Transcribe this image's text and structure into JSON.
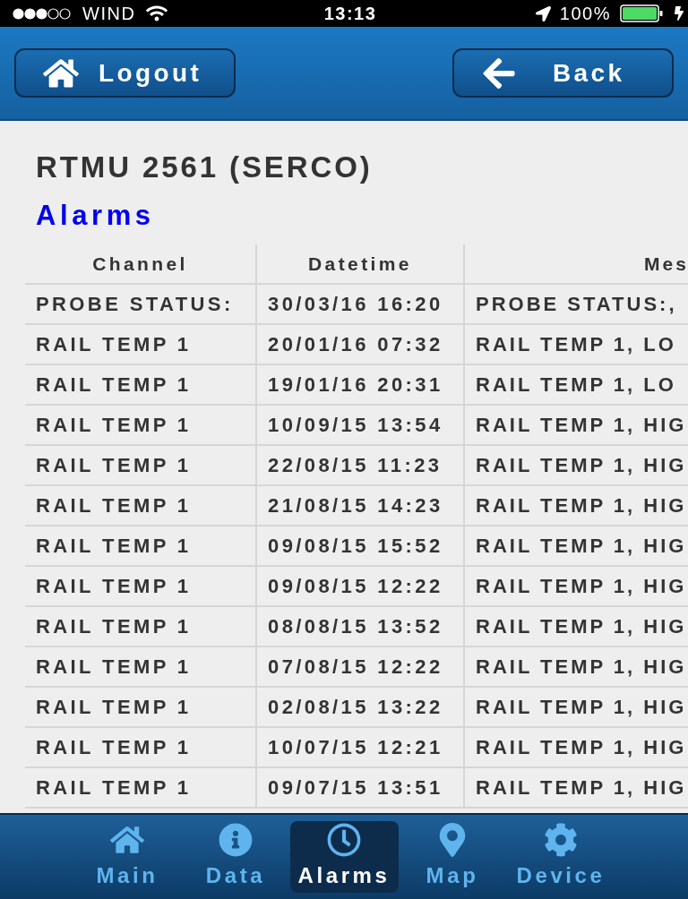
{
  "status_bar": {
    "carrier": "WIND",
    "time": "13:13",
    "battery": "100%"
  },
  "header": {
    "buttons": [
      {
        "label": "Logout",
        "kind": "home"
      },
      {
        "label": "Back",
        "kind": "back"
      }
    ]
  },
  "title": "RTMU 2561 (SERCO)",
  "section_title": "Alarms",
  "table": {
    "columns": [
      "Channel",
      "Datetime",
      "Mes"
    ],
    "rows": [
      [
        "PROBE STATUS:",
        "30/03/16 16:20",
        "PROBE STATUS:,"
      ],
      [
        "RAIL TEMP 1",
        "20/01/16 07:32",
        "RAIL TEMP 1, LO"
      ],
      [
        "RAIL TEMP 1",
        "19/01/16 20:31",
        "RAIL TEMP 1, LO"
      ],
      [
        "RAIL TEMP 1",
        "10/09/15 13:54",
        "RAIL TEMP 1, HIG"
      ],
      [
        "RAIL TEMP 1",
        "22/08/15 11:23",
        "RAIL TEMP 1, HIG"
      ],
      [
        "RAIL TEMP 1",
        "21/08/15 14:23",
        "RAIL TEMP 1, HIG"
      ],
      [
        "RAIL TEMP 1",
        "09/08/15 15:52",
        "RAIL TEMP 1, HIG"
      ],
      [
        "RAIL TEMP 1",
        "09/08/15 12:22",
        "RAIL TEMP 1, HIG"
      ],
      [
        "RAIL TEMP 1",
        "08/08/15 13:52",
        "RAIL TEMP 1, HIG"
      ],
      [
        "RAIL TEMP 1",
        "07/08/15 12:22",
        "RAIL TEMP 1, HIG"
      ],
      [
        "RAIL TEMP 1",
        "02/08/15 13:22",
        "RAIL TEMP 1, HIG"
      ],
      [
        "RAIL TEMP 1",
        "10/07/15 12:21",
        "RAIL TEMP 1, HIG"
      ],
      [
        "RAIL TEMP 1",
        "09/07/15 13:51",
        "RAIL TEMP 1, HIG"
      ]
    ]
  },
  "tab_bar": {
    "tabs": [
      {
        "label": "Main",
        "kind": "home",
        "selected": false
      },
      {
        "label": "Data",
        "kind": "info",
        "selected": false
      },
      {
        "label": "Alarms",
        "kind": "clock",
        "selected": true
      },
      {
        "label": "Map",
        "kind": "pin",
        "selected": false
      },
      {
        "label": "Device",
        "kind": "gear",
        "selected": false
      }
    ]
  }
}
